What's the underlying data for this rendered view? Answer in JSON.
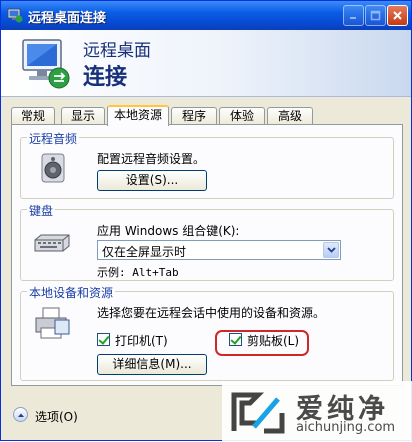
{
  "window": {
    "title": "远程桌面连接"
  },
  "banner": {
    "line1": "远程桌面",
    "line2": "连接"
  },
  "tabs": [
    {
      "label": "常规"
    },
    {
      "label": "显示"
    },
    {
      "label": "本地资源"
    },
    {
      "label": "程序"
    },
    {
      "label": "体验"
    },
    {
      "label": "高级"
    }
  ],
  "audio": {
    "group_title": "远程音频",
    "description": "配置远程音频设置。",
    "settings_button": "设置(S)..."
  },
  "keyboard": {
    "group_title": "键盘",
    "label": "应用 Windows 组合键(K):",
    "selected": "仅在全屏显示时",
    "example": "示例: Alt+Tab"
  },
  "devices": {
    "group_title": "本地设备和资源",
    "description": "选择您要在远程会话中使用的设备和资源。",
    "printer_label": "打印机(T)",
    "clipboard_label": "剪贴板(L)",
    "details_button": "详细信息(M)..."
  },
  "footer": {
    "options_label": "选项(O)"
  },
  "watermark": {
    "text": "爱纯净",
    "url": "aichunjing.com"
  }
}
